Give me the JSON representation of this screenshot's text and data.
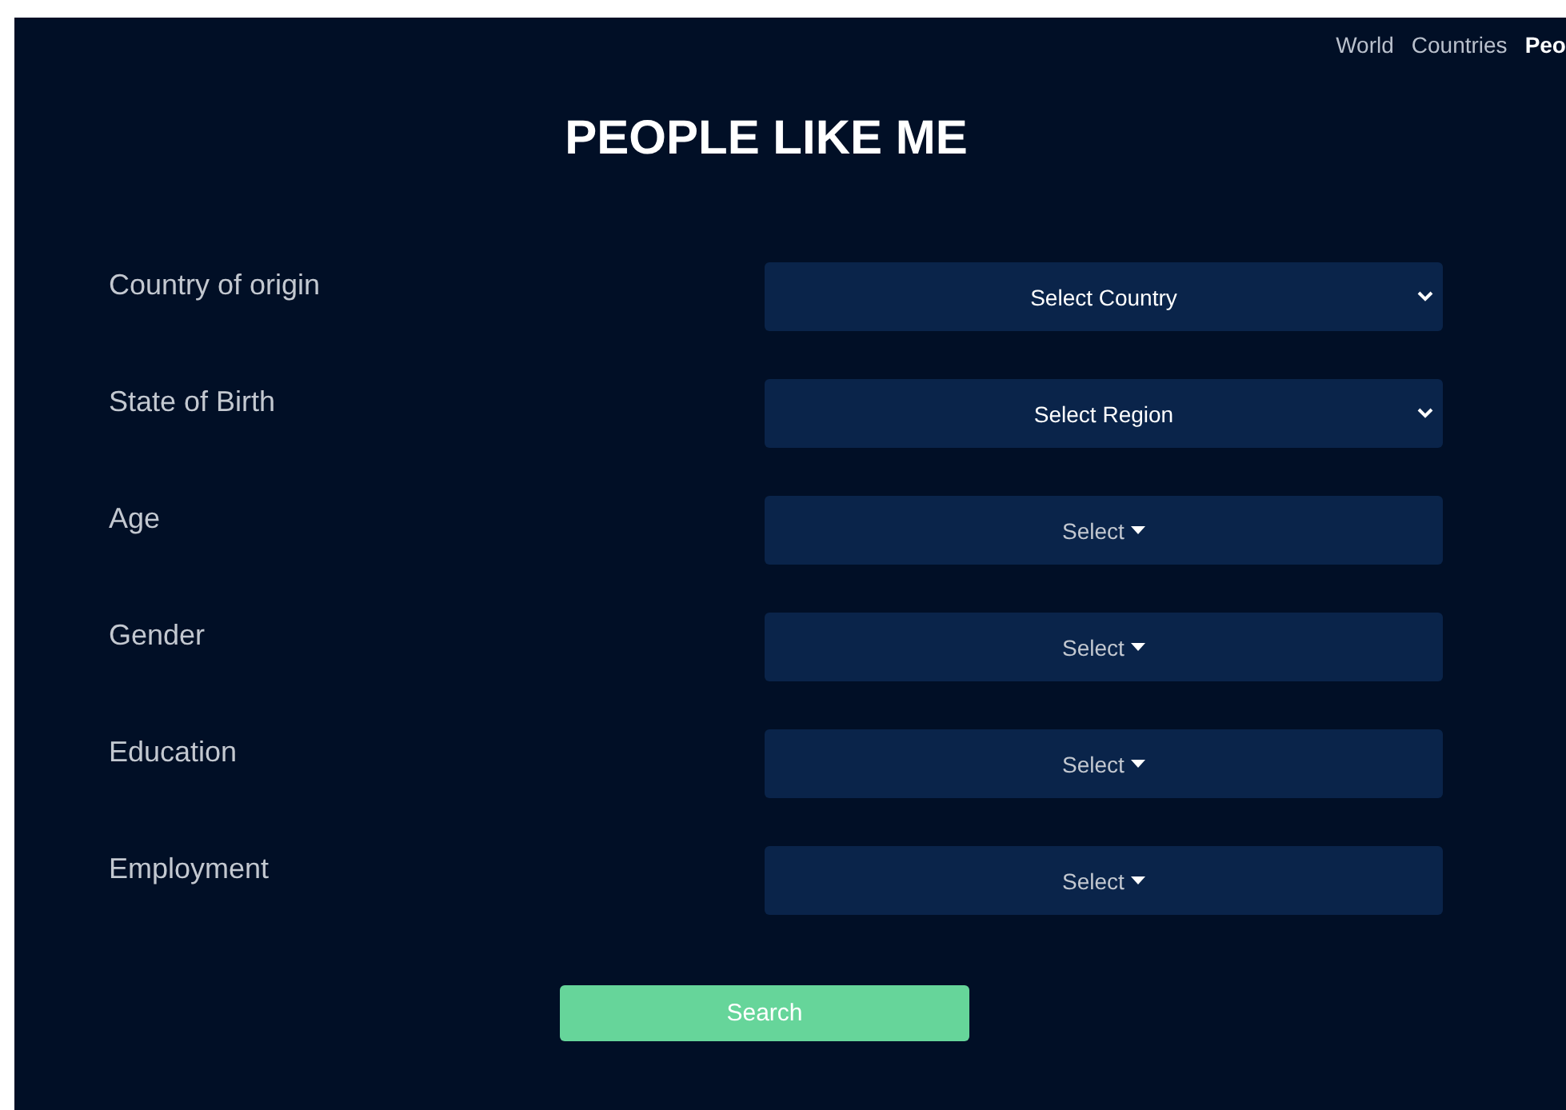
{
  "nav": [
    {
      "label": "World",
      "selected": false
    },
    {
      "label": "Countries",
      "selected": false
    },
    {
      "label": "Peo",
      "selected": true
    }
  ],
  "title": "PEOPLE LIKE ME",
  "fields": [
    {
      "label": "Country of origin",
      "kind": "select",
      "value": "Select Country"
    },
    {
      "label": "State of Birth",
      "kind": "select",
      "value": "Select Region"
    },
    {
      "label": "Age",
      "kind": "dropdown",
      "value": "Select"
    },
    {
      "label": "Gender",
      "kind": "dropdown",
      "value": "Select"
    },
    {
      "label": "Education",
      "kind": "dropdown",
      "value": "Select"
    },
    {
      "label": "Employment",
      "kind": "dropdown",
      "value": "Select"
    }
  ],
  "search_button": "Search"
}
